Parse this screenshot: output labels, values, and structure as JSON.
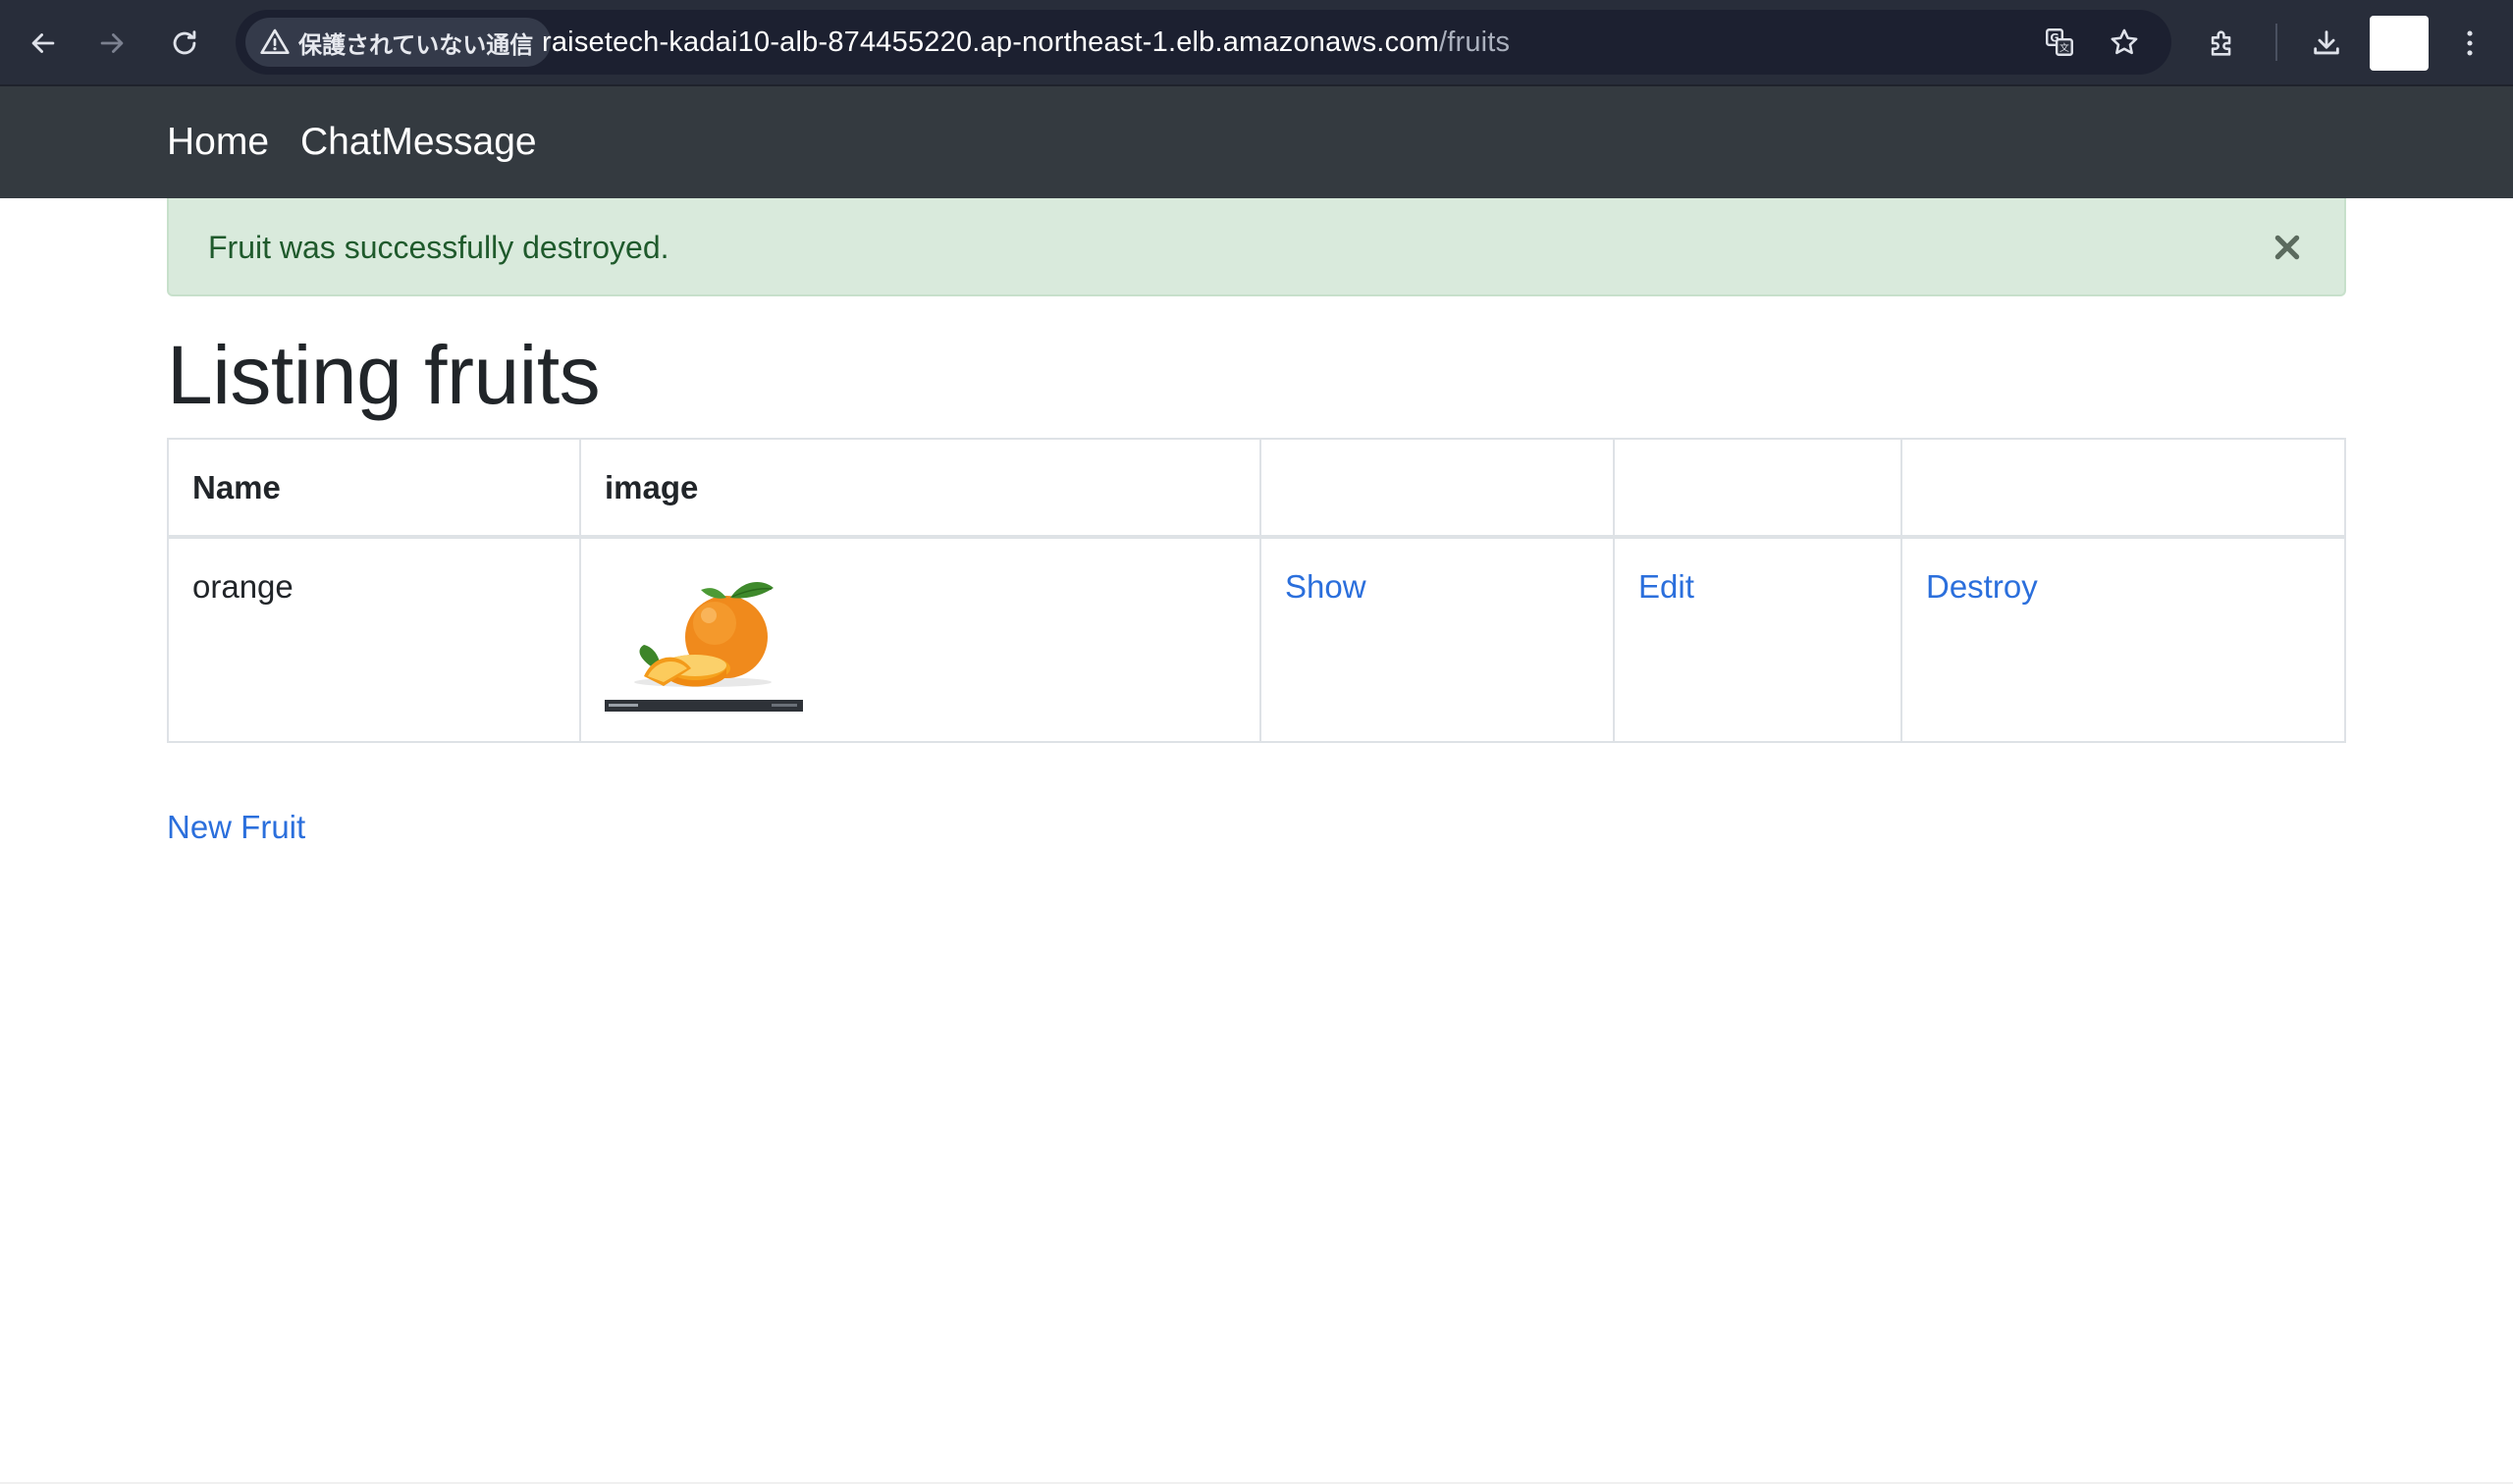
{
  "browser": {
    "security_label": "保護されていない通信",
    "url_host": "raisetech-kadai10-alb-874455220.ap-northeast-1.elb.amazonaws.com",
    "url_path": "/fruits",
    "icons": [
      "back-icon",
      "forward-icon",
      "reload-icon",
      "warning-icon",
      "translate-icon",
      "star-icon",
      "extensions-icon",
      "download-icon",
      "more-icon"
    ]
  },
  "nav": {
    "home": "Home",
    "chat": "ChatMessage"
  },
  "alert": {
    "message": "Fruit was successfully destroyed."
  },
  "page": {
    "title": "Listing fruits"
  },
  "table": {
    "headers": [
      "Name",
      "image",
      "",
      "",
      ""
    ],
    "rows": [
      {
        "name": "orange",
        "show": "Show",
        "edit": "Edit",
        "destroy": "Destroy"
      }
    ]
  },
  "actions": {
    "new_fruit": "New Fruit"
  },
  "colors": {
    "navbar": "#343a40",
    "alert_bg": "#d9eadc",
    "alert_text": "#1f5a2c",
    "link": "#2b6fdc"
  }
}
